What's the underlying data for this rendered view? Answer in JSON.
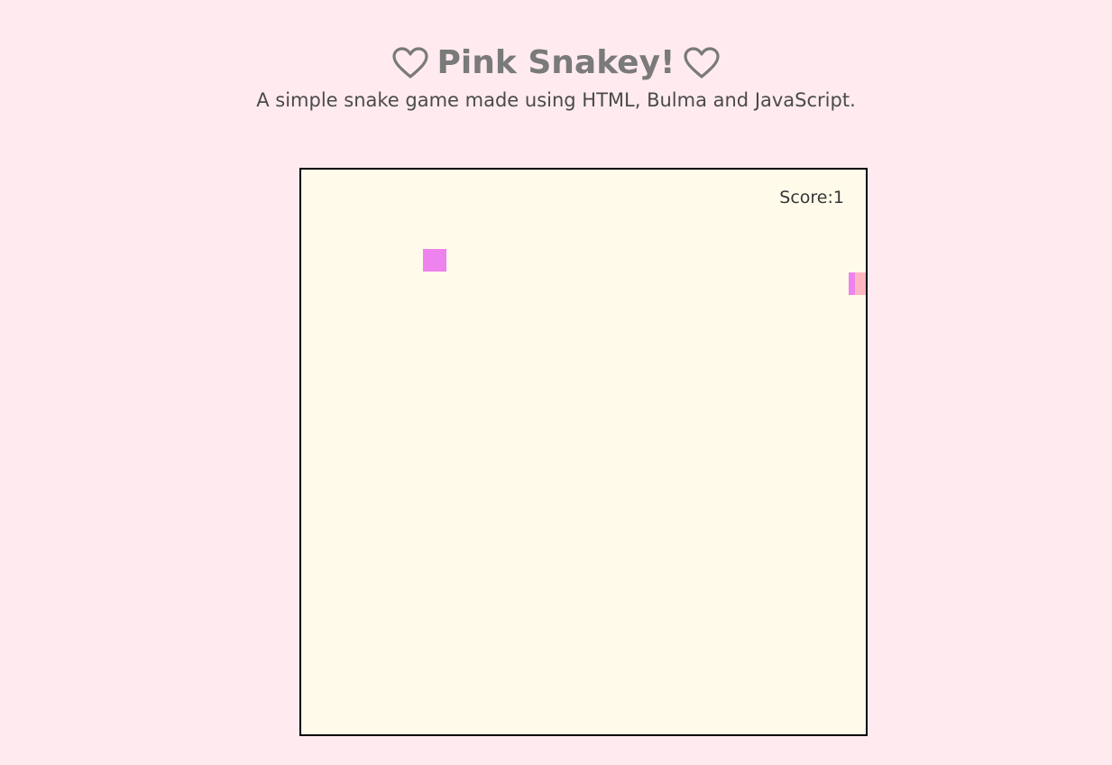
{
  "header": {
    "title": "Pink Snakey!",
    "subtitle": "A simple snake game made using HTML, Bulma and JavaScript.",
    "icon_left": "heart-outline-icon",
    "icon_right": "heart-outline-icon"
  },
  "game": {
    "score_label": "Score:",
    "score_value": "1",
    "colors": {
      "page_background": "#ffebef",
      "board_background": "#fffaea",
      "food": "#ee82ee",
      "snake_head": "#ee82ee",
      "snake_body": "#ffb6c1"
    }
  }
}
